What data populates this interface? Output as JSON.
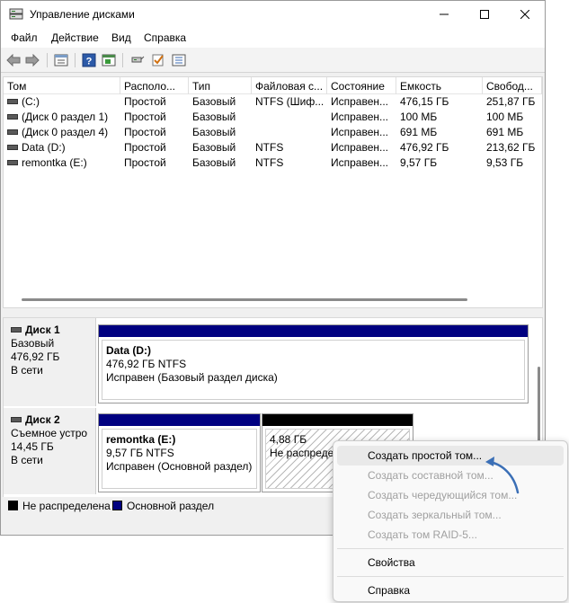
{
  "window": {
    "title": "Управление дисками",
    "controls": [
      "minimize-icon",
      "maximize-icon",
      "close-icon"
    ]
  },
  "menu": [
    "Файл",
    "Действие",
    "Вид",
    "Справка"
  ],
  "toolbar": [
    "back-icon",
    "forward-icon",
    "properties-icon",
    "help-icon",
    "console-icon",
    "connect-icon",
    "check-icon",
    "list-icon"
  ],
  "volumes": {
    "columns": [
      "Том",
      "Располо...",
      "Тип",
      "Файловая с...",
      "Состояние",
      "Емкость",
      "Свобод..."
    ],
    "rows": [
      {
        "name": "(C:)",
        "layout": "Простой",
        "type": "Базовый",
        "fs": "NTFS (Шиф...",
        "status": "Исправен...",
        "capacity": "476,15 ГБ",
        "free": "251,87 ГБ"
      },
      {
        "name": "(Диск 0 раздел 1)",
        "layout": "Простой",
        "type": "Базовый",
        "fs": "",
        "status": "Исправен...",
        "capacity": "100 МБ",
        "free": "100 МБ"
      },
      {
        "name": "(Диск 0 раздел 4)",
        "layout": "Простой",
        "type": "Базовый",
        "fs": "",
        "status": "Исправен...",
        "capacity": "691 МБ",
        "free": "691 МБ"
      },
      {
        "name": "Data (D:)",
        "layout": "Простой",
        "type": "Базовый",
        "fs": "NTFS",
        "status": "Исправен...",
        "capacity": "476,92 ГБ",
        "free": "213,62 ГБ"
      },
      {
        "name": "remontka (E:)",
        "layout": "Простой",
        "type": "Базовый",
        "fs": "NTFS",
        "status": "Исправен...",
        "capacity": "9,57 ГБ",
        "free": "9,53 ГБ"
      }
    ]
  },
  "disks": {
    "disk1": {
      "name": "Диск 1",
      "kind": "Базовый",
      "size": "476,92 ГБ",
      "state": "В сети",
      "partition": {
        "title": "Data  (D:)",
        "size": "476,92 ГБ NTFS",
        "status": "Исправен (Базовый раздел диска)"
      }
    },
    "disk2": {
      "name": "Диск 2",
      "kind": "Съемное устро",
      "size": "14,45 ГБ",
      "state": "В сети",
      "partition": {
        "title": "remontka  (E:)",
        "size": "9,57 ГБ NTFS",
        "status": "Исправен (Основной раздел)"
      },
      "unallocated": {
        "size": "4,88 ГБ",
        "status": "Не распреде"
      }
    }
  },
  "legend": {
    "unallocated": "Не распределена",
    "primary": "Основной раздел",
    "unallocated_color": "#000000",
    "primary_color": "#000080"
  },
  "context_menu": {
    "items": [
      {
        "label": "Создать простой том...",
        "enabled": true
      },
      {
        "label": "Создать составной том...",
        "enabled": false
      },
      {
        "label": "Создать чередующийся том...",
        "enabled": false
      },
      {
        "label": "Создать зеркальный том...",
        "enabled": false
      },
      {
        "label": "Создать том RAID-5...",
        "enabled": false
      },
      {
        "label": "Свойства",
        "enabled": true
      },
      {
        "label": "Справка",
        "enabled": true
      }
    ]
  }
}
